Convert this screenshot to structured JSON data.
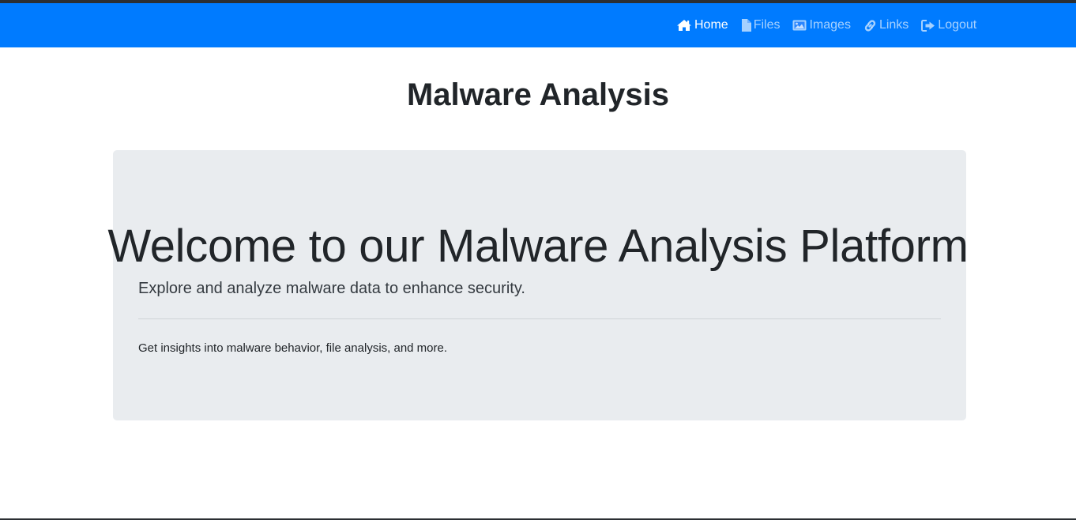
{
  "navbar": {
    "background_color": "#007bff",
    "items": [
      {
        "label": "Home",
        "icon": "home-icon",
        "active": true
      },
      {
        "label": "Files",
        "icon": "file-icon",
        "active": false
      },
      {
        "label": "Images",
        "icon": "image-icon",
        "active": false
      },
      {
        "label": "Links",
        "icon": "link-icon",
        "active": false
      },
      {
        "label": "Logout",
        "icon": "logout-icon",
        "active": false
      }
    ]
  },
  "page": {
    "title": "Malware Analysis"
  },
  "jumbotron": {
    "heading": "Welcome to our Malware Analysis Platform",
    "lead": "Explore and analyze malware data to enhance security.",
    "text": "Get insights into malware behavior, file analysis, and more."
  }
}
